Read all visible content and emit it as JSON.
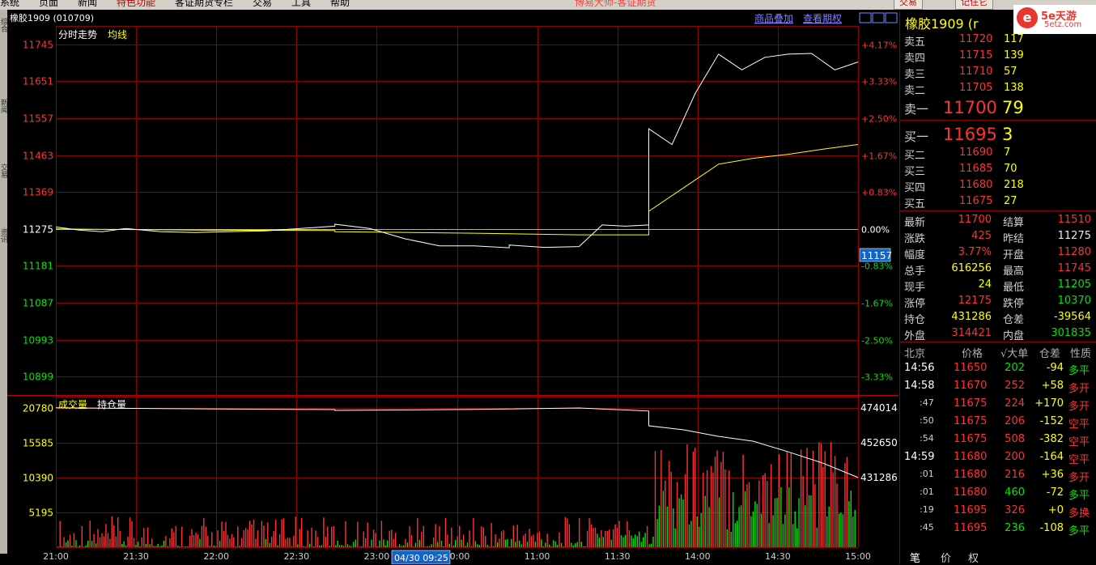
{
  "menu": {
    "items": [
      "系统",
      "页面",
      "新闻",
      "特色功能",
      "客证期货专栏",
      "交易",
      "工具",
      "帮助"
    ],
    "title": "博易大师-客证期货",
    "trade_button": "交易",
    "account_button": "记住它"
  },
  "chart": {
    "symbol_label": "橡胶1909 (010709)",
    "price_legend": "分时走势",
    "avg_legend": "均线",
    "overlay_link": "商品叠加",
    "options_link": "查看期权",
    "vol_legend": "成交量",
    "oi_legend": "持仓量",
    "price_ticks": [
      "11745",
      "11651",
      "11557",
      "11463",
      "11369",
      "11275",
      "11181",
      "11087",
      "10993",
      "10899"
    ],
    "pct_ticks": [
      "+4.17%",
      "+3.33%",
      "+2.50%",
      "+1.67%",
      "+0.83%",
      "0.00%",
      "-0.83%",
      "-1.67%",
      "-2.50%",
      "-3.33%"
    ],
    "cursor_price": "11157",
    "vol_ticks": [
      "20780",
      "15585",
      "10390",
      "5195"
    ],
    "oi_ticks": [
      "474014",
      "452650",
      "431286"
    ],
    "time_ticks": [
      "21:00",
      "21:30",
      "22:00",
      "22:30",
      "23:00",
      "10:00",
      "11:00",
      "11:30",
      "14:00",
      "14:30",
      "15:00"
    ],
    "cursor_time": "04/30 09:25"
  },
  "chart_data": {
    "type": "line",
    "title": "橡胶1909 (010709)",
    "xlabel": "",
    "ylabel": "",
    "ylim": [
      10852,
      11792
    ],
    "prev_settle": 11275,
    "series": [
      {
        "name": "分时走势",
        "x": [
          "21:00",
          "21:10",
          "21:20",
          "21:30",
          "21:45",
          "22:00",
          "22:30",
          "23:00",
          "09:00",
          "09:15",
          "09:30",
          "09:45",
          "10:00",
          "10:15",
          "10:30",
          "10:45",
          "11:00",
          "11:10",
          "11:20",
          "11:30",
          "13:30",
          "13:40",
          "13:50",
          "14:00",
          "14:10",
          "14:20",
          "14:30",
          "14:40",
          "14:50",
          "15:00"
        ],
        "values": [
          11280,
          11272,
          11268,
          11276,
          11268,
          11266,
          11270,
          11282,
          11287,
          11276,
          11250,
          11232,
          11232,
          11227,
          11234,
          11228,
          11230,
          11285,
          11282,
          11285,
          11530,
          11490,
          11620,
          11720,
          11680,
          11712,
          11720,
          11722,
          11680,
          11700
        ]
      },
      {
        "name": "均线",
        "x": [
          "21:00",
          "22:00",
          "23:00",
          "09:00",
          "10:00",
          "11:00",
          "11:30",
          "13:30",
          "13:45",
          "14:00",
          "14:15",
          "14:30",
          "14:45",
          "15:00"
        ],
        "values": [
          11275,
          11272,
          11271,
          11268,
          11264,
          11260,
          11260,
          11320,
          11380,
          11440,
          11455,
          11465,
          11478,
          11490
        ]
      },
      {
        "name": "持仓量",
        "x": [
          "21:00",
          "22:00",
          "23:00",
          "09:00",
          "10:00",
          "11:00",
          "11:30",
          "13:30",
          "13:45",
          "14:00",
          "14:15",
          "14:30",
          "14:45",
          "15:00"
        ],
        "values": [
          474014,
          473400,
          472900,
          472400,
          473000,
          473900,
          472000,
          463000,
          460500,
          456500,
          453500,
          447000,
          440000,
          431286
        ]
      }
    ]
  },
  "quote": {
    "title": "橡胶1909 (r",
    "asks": [
      {
        "label": "卖五",
        "price": "11720",
        "vol": "117"
      },
      {
        "label": "卖四",
        "price": "11715",
        "vol": "139"
      },
      {
        "label": "卖三",
        "price": "11710",
        "vol": "57"
      },
      {
        "label": "卖二",
        "price": "11705",
        "vol": "138"
      },
      {
        "label": "卖一",
        "price": "11700",
        "vol": "79"
      }
    ],
    "bids": [
      {
        "label": "买一",
        "price": "11695",
        "vol": "3"
      },
      {
        "label": "买二",
        "price": "11690",
        "vol": "7"
      },
      {
        "label": "买三",
        "price": "11685",
        "vol": "70"
      },
      {
        "label": "买四",
        "price": "11680",
        "vol": "218"
      },
      {
        "label": "买五",
        "price": "11675",
        "vol": "27"
      }
    ],
    "stats": [
      {
        "l1": "最新",
        "v1": "11700",
        "c1": "red",
        "l2": "结算",
        "v2": "11510",
        "c2": "red"
      },
      {
        "l1": "涨跌",
        "v1": "425",
        "c1": "red",
        "l2": "昨结",
        "v2": "11275",
        "c2": "white"
      },
      {
        "l1": "幅度",
        "v1": "3.77%",
        "c1": "red",
        "l2": "开盘",
        "v2": "11280",
        "c2": "red"
      },
      {
        "l1": "总手",
        "v1": "616256",
        "c1": "yellow",
        "l2": "最高",
        "v2": "11745",
        "c2": "red"
      },
      {
        "l1": "现手",
        "v1": "24",
        "c1": "yellow",
        "l2": "最低",
        "v2": "11205",
        "c2": "green"
      },
      {
        "l1": "涨停",
        "v1": "12175",
        "c1": "red",
        "l2": "跌停",
        "v2": "10370",
        "c2": "green"
      },
      {
        "l1": "持仓",
        "v1": "431286",
        "c1": "yellow",
        "l2": "仓差",
        "v2": "-39564",
        "c2": "yellow"
      },
      {
        "l1": "外盘",
        "v1": "314421",
        "c1": "red",
        "l2": "内盘",
        "v2": "301835",
        "c2": "green"
      }
    ]
  },
  "ticks": {
    "headers": [
      "北京",
      "价格",
      "√大单",
      "仓差",
      "性质"
    ],
    "rows": [
      {
        "time": "14:56",
        "price": "11650",
        "vol": "202",
        "vol_c": "green",
        "oi": "-94",
        "type": "多平",
        "type_c": "green",
        "bright": true
      },
      {
        "time": "14:58",
        "price": "11670",
        "vol": "252",
        "vol_c": "red",
        "oi": "+58",
        "type": "多开",
        "type_c": "red",
        "bright": true
      },
      {
        "time": ":47",
        "price": "11675",
        "vol": "224",
        "vol_c": "red",
        "oi": "+170",
        "type": "多开",
        "type_c": "red",
        "bright": false
      },
      {
        "time": ":50",
        "price": "11675",
        "vol": "206",
        "vol_c": "red",
        "oi": "-152",
        "type": "空平",
        "type_c": "red",
        "bright": false
      },
      {
        "time": ":54",
        "price": "11675",
        "vol": "508",
        "vol_c": "red",
        "oi": "-382",
        "type": "空平",
        "type_c": "red",
        "bright": false
      },
      {
        "time": "14:59",
        "price": "11680",
        "vol": "200",
        "vol_c": "red",
        "oi": "-164",
        "type": "空平",
        "type_c": "red",
        "bright": true
      },
      {
        "time": ":01",
        "price": "11680",
        "vol": "216",
        "vol_c": "red",
        "oi": "+36",
        "type": "多开",
        "type_c": "red",
        "bright": false
      },
      {
        "time": ":01",
        "price": "11680",
        "vol": "460",
        "vol_c": "green",
        "oi": "-72",
        "type": "多平",
        "type_c": "green",
        "bright": false
      },
      {
        "time": ":19",
        "price": "11695",
        "vol": "326",
        "vol_c": "red",
        "oi": "+0",
        "type": "多换",
        "type_c": "red",
        "bright": false
      },
      {
        "time": ":45",
        "price": "11695",
        "vol": "236",
        "vol_c": "green",
        "oi": "-108",
        "type": "多平",
        "type_c": "green",
        "bright": false
      }
    ],
    "tabs": [
      "笔",
      "价",
      "权"
    ]
  },
  "logo": {
    "mark": "e",
    "text": "5e天游",
    "sub": "5etz.com"
  },
  "left_strip": [
    "综合",
    "新闻",
    "交易",
    "资讯"
  ],
  "colors": {
    "grid": "#8b0000",
    "price_line": "#ffffff",
    "avg_line": "#ffff00",
    "up": "#ff3232",
    "down": "#00e600",
    "axis_red": "#ff3232"
  }
}
